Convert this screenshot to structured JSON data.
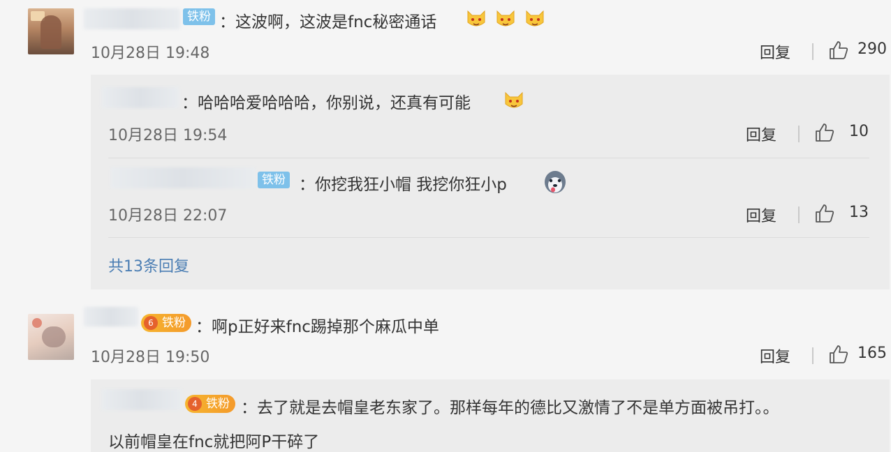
{
  "comments": [
    {
      "badge": "铁粉",
      "text": "：这波啊，这波是fnc秘密通话",
      "time": "10月28日 19:48",
      "reply_label": "回复",
      "likes": "290",
      "emoji_icon": "cat-face-emoji"
    },
    {
      "badge": "铁粉",
      "badge_level": "6",
      "name_fragment": "ILTO",
      "text": "：啊p正好来fnc踢掉那个麻瓜中单",
      "time": "10月28日 19:50",
      "reply_label": "回复",
      "likes": "165"
    }
  ],
  "replies_1": [
    {
      "text": "：哈哈哈爱哈哈哈，你别说，还真有可能",
      "time": "10月28日 19:54",
      "reply_label": "回复",
      "likes": "10",
      "emoji_icon": "cat-face-emoji"
    },
    {
      "badge": "铁粉",
      "text": "：你挖我狂小帽  我挖你狂小p",
      "time": "10月28日 22:07",
      "reply_label": "回复",
      "likes": "13",
      "emoji_icon": "husky-face-emoji"
    }
  ],
  "more_replies_label": "共13条回复",
  "replies_2": [
    {
      "badge": "铁粉",
      "badge_level": "4",
      "text_line1": "：去了就是去帽皇老东家了。那样每年的德比又激情了不是单方面被吊打。。",
      "text_line2": "以前帽皇在fnc就把阿P干碎了"
    }
  ],
  "colors": {
    "link": "#4a7db3",
    "badge_blue": "#7ec1ea",
    "badge_orange": "#f49a2b",
    "panel": "#ececec"
  }
}
